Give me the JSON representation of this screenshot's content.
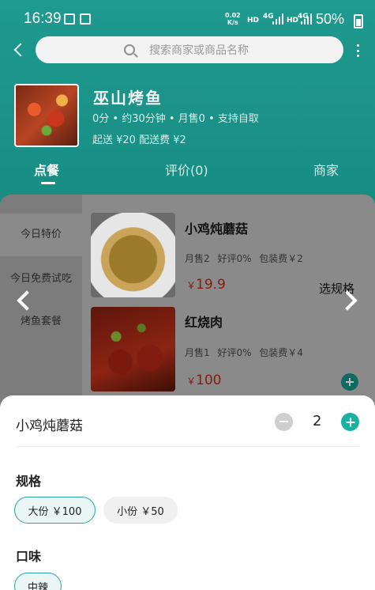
{
  "status_bar": {
    "time": "16:39",
    "net_speed_value": "0.02",
    "net_speed_unit": "K/s",
    "hd1": "HD",
    "lte1": "4G",
    "hd2": "HD",
    "lte2": "4G",
    "battery": "50%"
  },
  "search": {
    "placeholder": "搜索商家或商品名称"
  },
  "shop": {
    "name": "巫山烤鱼",
    "meta": "0分 • 约30分钟 • 月售0 • 支持自取",
    "fees": "起送 ¥20 配送费 ¥2"
  },
  "tabs": [
    {
      "label": "点餐",
      "active": true
    },
    {
      "label": "评价(0)",
      "active": false
    },
    {
      "label": "商家",
      "active": false
    }
  ],
  "categories": [
    {
      "label": "今日特价",
      "active": true
    },
    {
      "label": "今日免费试吃",
      "active": false
    },
    {
      "label": "烤鱼套餐",
      "active": false
    }
  ],
  "products": [
    {
      "name": "小鸡炖蘑菇",
      "stats": "月售2 好评0% 包装费￥2",
      "currency": "￥",
      "price": "19.9",
      "action_label": "选规格"
    },
    {
      "name": "红烧肉",
      "stats": "月售1 好评0% 包装费￥4",
      "currency": "￥",
      "price": "100"
    }
  ],
  "sheet": {
    "product_name": "小鸡炖蘑菇",
    "quantity": "2",
    "spec_title": "规格",
    "spec_options": [
      {
        "label": "大份 ￥100",
        "selected": true
      },
      {
        "label": "小份 ￥50",
        "selected": false
      }
    ],
    "taste_title": "口味",
    "taste_options": [
      {
        "label": "中辣",
        "selected": true
      }
    ]
  },
  "colors": {
    "brand_teal": "#1a9187",
    "accent_button": "#1bb0a4",
    "price_red": "#c8401c"
  }
}
